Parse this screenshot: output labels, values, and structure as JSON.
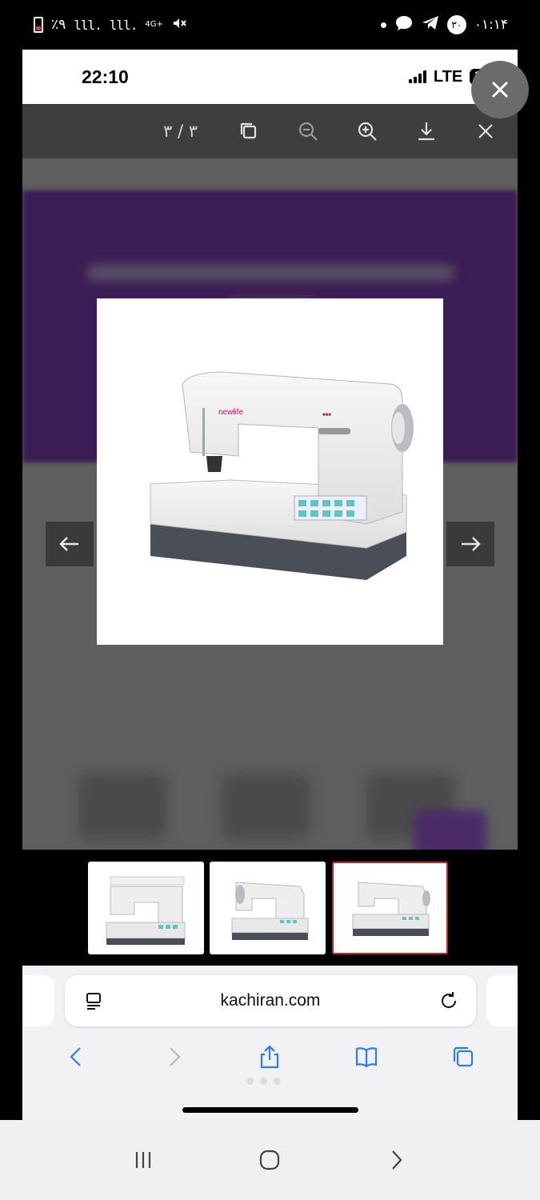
{
  "android_status": {
    "battery_percent": "٪۹",
    "signal1": "lll.",
    "signal2": "lll.",
    "network": "4G+",
    "notif_badge": "۳۰",
    "time": "۰۱:۱۴"
  },
  "ios_status": {
    "time": "22:10",
    "network": "LTE",
    "battery": "28"
  },
  "viewer": {
    "counter": "۳ / ۳",
    "icons": [
      "copy-icon",
      "zoom-out-icon",
      "zoom-in-icon",
      "download-icon",
      "close-icon"
    ]
  },
  "thumbnails": {
    "count": 3,
    "active_index": 2
  },
  "safari": {
    "address": "kachiran.com",
    "nav_icons": [
      "back-icon",
      "forward-icon",
      "share-icon",
      "bookmarks-icon",
      "tabs-icon"
    ]
  },
  "colors": {
    "accent": "#2d7cf6",
    "active_thumb_border": "#c1272d",
    "toolbar_bg": "#3e3e3e",
    "backdrop_purple": "#3a1d54"
  }
}
